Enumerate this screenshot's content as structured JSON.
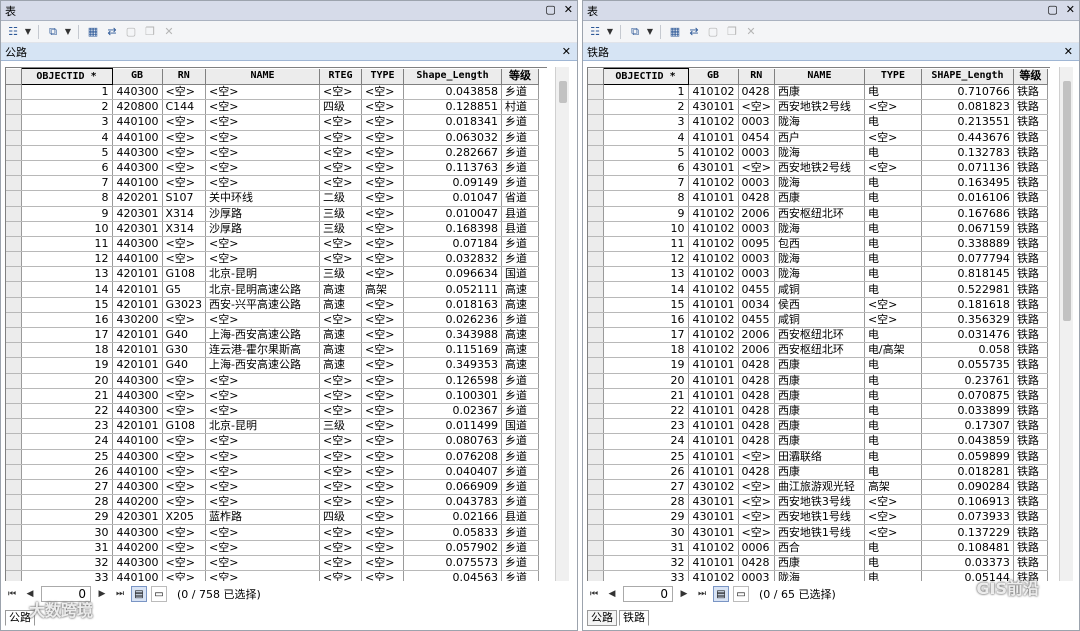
{
  "left": {
    "window_title": "表",
    "table_tab": "公路",
    "columns": [
      "OBJECTID *",
      "GB",
      "RN",
      "NAME",
      "RTEG",
      "TYPE",
      "Shape_Length",
      "等级"
    ],
    "rows": [
      [
        "1",
        "440300",
        "<空>",
        "<空>",
        "<空>",
        "<空>",
        "0.043858",
        "乡道"
      ],
      [
        "2",
        "420800",
        "C144",
        "<空>",
        "四级",
        "<空>",
        "0.128851",
        "村道"
      ],
      [
        "3",
        "440100",
        "<空>",
        "<空>",
        "<空>",
        "<空>",
        "0.018341",
        "乡道"
      ],
      [
        "4",
        "440100",
        "<空>",
        "<空>",
        "<空>",
        "<空>",
        "0.063032",
        "乡道"
      ],
      [
        "5",
        "440300",
        "<空>",
        "<空>",
        "<空>",
        "<空>",
        "0.282667",
        "乡道"
      ],
      [
        "6",
        "440300",
        "<空>",
        "<空>",
        "<空>",
        "<空>",
        "0.113763",
        "乡道"
      ],
      [
        "7",
        "440100",
        "<空>",
        "<空>",
        "<空>",
        "<空>",
        "0.09149",
        "乡道"
      ],
      [
        "8",
        "420201",
        "S107",
        "关中环线",
        "二级",
        "<空>",
        "0.01047",
        "省道"
      ],
      [
        "9",
        "420301",
        "X314",
        "沙厚路",
        "三级",
        "<空>",
        "0.010047",
        "县道"
      ],
      [
        "10",
        "420301",
        "X314",
        "沙厚路",
        "三级",
        "<空>",
        "0.168398",
        "县道"
      ],
      [
        "11",
        "440300",
        "<空>",
        "<空>",
        "<空>",
        "<空>",
        "0.07184",
        "乡道"
      ],
      [
        "12",
        "440100",
        "<空>",
        "<空>",
        "<空>",
        "<空>",
        "0.032832",
        "乡道"
      ],
      [
        "13",
        "420101",
        "G108",
        "北京-昆明",
        "三级",
        "<空>",
        "0.096634",
        "国道"
      ],
      [
        "14",
        "420101",
        "G5",
        "北京-昆明高速公路",
        "高速",
        "高架",
        "0.052111",
        "高速"
      ],
      [
        "15",
        "420101",
        "G3023",
        "西安-兴平高速公路",
        "高速",
        "<空>",
        "0.018163",
        "高速"
      ],
      [
        "16",
        "430200",
        "<空>",
        "<空>",
        "<空>",
        "<空>",
        "0.026236",
        "乡道"
      ],
      [
        "17",
        "420101",
        "G40",
        "上海-西安高速公路",
        "高速",
        "<空>",
        "0.343988",
        "高速"
      ],
      [
        "18",
        "420101",
        "G30",
        "连云港-霍尔果斯高",
        "高速",
        "<空>",
        "0.115169",
        "高速"
      ],
      [
        "19",
        "420101",
        "G40",
        "上海-西安高速公路",
        "高速",
        "<空>",
        "0.349353",
        "高速"
      ],
      [
        "20",
        "440300",
        "<空>",
        "<空>",
        "<空>",
        "<空>",
        "0.126598",
        "乡道"
      ],
      [
        "21",
        "440300",
        "<空>",
        "<空>",
        "<空>",
        "<空>",
        "0.100301",
        "乡道"
      ],
      [
        "22",
        "440300",
        "<空>",
        "<空>",
        "<空>",
        "<空>",
        "0.02367",
        "乡道"
      ],
      [
        "23",
        "420101",
        "G108",
        "北京-昆明",
        "三级",
        "<空>",
        "0.011499",
        "国道"
      ],
      [
        "24",
        "440100",
        "<空>",
        "<空>",
        "<空>",
        "<空>",
        "0.080763",
        "乡道"
      ],
      [
        "25",
        "440300",
        "<空>",
        "<空>",
        "<空>",
        "<空>",
        "0.076208",
        "乡道"
      ],
      [
        "26",
        "440100",
        "<空>",
        "<空>",
        "<空>",
        "<空>",
        "0.040407",
        "乡道"
      ],
      [
        "27",
        "440300",
        "<空>",
        "<空>",
        "<空>",
        "<空>",
        "0.066909",
        "乡道"
      ],
      [
        "28",
        "440200",
        "<空>",
        "<空>",
        "<空>",
        "<空>",
        "0.043783",
        "乡道"
      ],
      [
        "29",
        "420301",
        "X205",
        "蓝柞路",
        "四级",
        "<空>",
        "0.02166",
        "县道"
      ],
      [
        "30",
        "440300",
        "<空>",
        "<空>",
        "<空>",
        "<空>",
        "0.05833",
        "乡道"
      ],
      [
        "31",
        "440200",
        "<空>",
        "<空>",
        "<空>",
        "<空>",
        "0.057902",
        "乡道"
      ],
      [
        "32",
        "440300",
        "<空>",
        "<空>",
        "<空>",
        "<空>",
        "0.075573",
        "乡道"
      ],
      [
        "33",
        "440100",
        "<空>",
        "<空>",
        "<空>",
        "<空>",
        "0.04563",
        "乡道"
      ]
    ],
    "record_value": "0",
    "selection_info": "(0 / 758 已选择)",
    "bottom_tabs": [
      "公路"
    ],
    "watermark": "大数跨境"
  },
  "right": {
    "window_title": "表",
    "table_tab": "铁路",
    "columns": [
      "OBJECTID *",
      "GB",
      "RN",
      "NAME",
      "TYPE",
      "SHAPE_Length",
      "等级"
    ],
    "rows": [
      [
        "1",
        "410102",
        "0428",
        "西康",
        "电",
        "0.710766",
        "铁路"
      ],
      [
        "2",
        "430101",
        "<空>",
        "西安地铁2号线",
        "<空>",
        "0.081823",
        "铁路"
      ],
      [
        "3",
        "410102",
        "0003",
        "陇海",
        "电",
        "0.213551",
        "铁路"
      ],
      [
        "4",
        "410101",
        "0454",
        "西户",
        "<空>",
        "0.443676",
        "铁路"
      ],
      [
        "5",
        "410102",
        "0003",
        "陇海",
        "电",
        "0.132783",
        "铁路"
      ],
      [
        "6",
        "430101",
        "<空>",
        "西安地铁2号线",
        "<空>",
        "0.071136",
        "铁路"
      ],
      [
        "7",
        "410102",
        "0003",
        "陇海",
        "电",
        "0.163495",
        "铁路"
      ],
      [
        "8",
        "410101",
        "0428",
        "西康",
        "电",
        "0.016106",
        "铁路"
      ],
      [
        "9",
        "410102",
        "2006",
        "西安枢纽北环",
        "电",
        "0.167686",
        "铁路"
      ],
      [
        "10",
        "410102",
        "0003",
        "陇海",
        "电",
        "0.067159",
        "铁路"
      ],
      [
        "11",
        "410102",
        "0095",
        "包西",
        "电",
        "0.338889",
        "铁路"
      ],
      [
        "12",
        "410102",
        "0003",
        "陇海",
        "电",
        "0.077794",
        "铁路"
      ],
      [
        "13",
        "410102",
        "0003",
        "陇海",
        "电",
        "0.818145",
        "铁路"
      ],
      [
        "14",
        "410102",
        "0455",
        "咸铜",
        "电",
        "0.522981",
        "铁路"
      ],
      [
        "15",
        "410101",
        "0034",
        "侯西",
        "<空>",
        "0.181618",
        "铁路"
      ],
      [
        "16",
        "410102",
        "0455",
        "咸铜",
        "<空>",
        "0.356329",
        "铁路"
      ],
      [
        "17",
        "410102",
        "2006",
        "西安枢纽北环",
        "电",
        "0.031476",
        "铁路"
      ],
      [
        "18",
        "410102",
        "2006",
        "西安枢纽北环",
        "电/高架",
        "0.058",
        "铁路"
      ],
      [
        "19",
        "410101",
        "0428",
        "西康",
        "电",
        "0.055735",
        "铁路"
      ],
      [
        "20",
        "410101",
        "0428",
        "西康",
        "电",
        "0.23761",
        "铁路"
      ],
      [
        "21",
        "410101",
        "0428",
        "西康",
        "电",
        "0.070875",
        "铁路"
      ],
      [
        "22",
        "410101",
        "0428",
        "西康",
        "电",
        "0.033899",
        "铁路"
      ],
      [
        "23",
        "410101",
        "0428",
        "西康",
        "电",
        "0.17307",
        "铁路"
      ],
      [
        "24",
        "410101",
        "0428",
        "西康",
        "电",
        "0.043859",
        "铁路"
      ],
      [
        "25",
        "410101",
        "<空>",
        "田灞联络",
        "电",
        "0.059899",
        "铁路"
      ],
      [
        "26",
        "410101",
        "0428",
        "西康",
        "电",
        "0.018281",
        "铁路"
      ],
      [
        "27",
        "430102",
        "<空>",
        "曲江旅游观光轻",
        "高架",
        "0.090284",
        "铁路"
      ],
      [
        "28",
        "430101",
        "<空>",
        "西安地铁3号线",
        "<空>",
        "0.106913",
        "铁路"
      ],
      [
        "29",
        "430101",
        "<空>",
        "西安地铁1号线",
        "<空>",
        "0.073933",
        "铁路"
      ],
      [
        "30",
        "430101",
        "<空>",
        "西安地铁1号线",
        "<空>",
        "0.137229",
        "铁路"
      ],
      [
        "31",
        "410102",
        "0006",
        "西合",
        "电",
        "0.108481",
        "铁路"
      ],
      [
        "32",
        "410101",
        "0428",
        "西康",
        "电",
        "0.03373",
        "铁路"
      ],
      [
        "33",
        "410102",
        "0003",
        "陇海",
        "电",
        "0.05144",
        "铁路"
      ]
    ],
    "record_value": "0",
    "selection_info": "(0 / 65 已选择)",
    "bottom_tabs": [
      "公路",
      "铁路"
    ],
    "watermark": "GIS前沿"
  },
  "icons": {
    "minimize": "▫",
    "close": "✕",
    "table_options": "☷",
    "related": "⧉",
    "select": "▦",
    "clear": "▢",
    "delete": "✕"
  }
}
